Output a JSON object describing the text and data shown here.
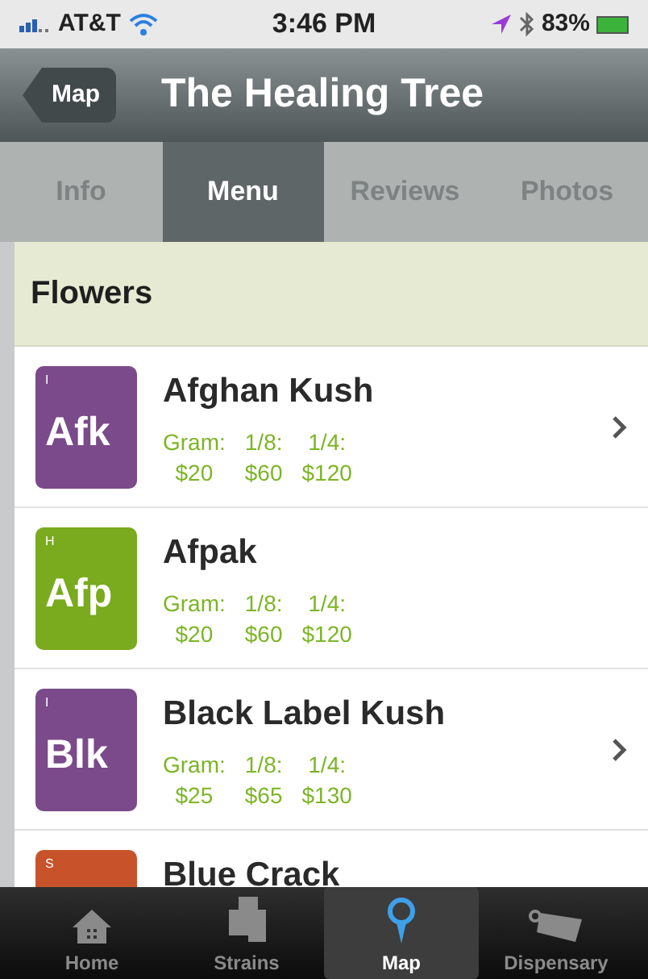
{
  "status_bar": {
    "carrier": "AT&T",
    "time": "3:46 PM",
    "battery": "83%"
  },
  "nav": {
    "back": "Map",
    "title": "The Healing Tree"
  },
  "tabs": [
    {
      "label": "Info",
      "selected": false
    },
    {
      "label": "Menu",
      "selected": true
    },
    {
      "label": "Reviews",
      "selected": false
    },
    {
      "label": "Photos",
      "selected": false
    }
  ],
  "section": "Flowers",
  "strains": [
    {
      "type_letter": "I",
      "abbr": "Afk",
      "color": "#7b4a8a",
      "name": "Afghan Kush",
      "chevron": true,
      "prices": [
        {
          "label": "Gram:",
          "value": "$20"
        },
        {
          "label": "1/8:",
          "value": "$60"
        },
        {
          "label": "1/4:",
          "value": "$120"
        }
      ]
    },
    {
      "type_letter": "H",
      "abbr": "Afp",
      "color": "#7aaa1e",
      "name": "Afpak",
      "chevron": false,
      "prices": [
        {
          "label": "Gram:",
          "value": "$20"
        },
        {
          "label": "1/8:",
          "value": "$60"
        },
        {
          "label": "1/4:",
          "value": "$120"
        }
      ]
    },
    {
      "type_letter": "I",
      "abbr": "Blk",
      "color": "#7b4a8a",
      "name": "Black Label Kush",
      "chevron": true,
      "prices": [
        {
          "label": "Gram:",
          "value": "$25"
        },
        {
          "label": "1/8:",
          "value": "$65"
        },
        {
          "label": "1/4:",
          "value": "$130"
        }
      ]
    },
    {
      "type_letter": "S",
      "color": "#c8532a",
      "name": "Blue Crack",
      "chevron": false
    }
  ],
  "tab_bar": [
    {
      "label": "Home",
      "kind": "home",
      "selected": false
    },
    {
      "label": "Strains",
      "kind": "strains",
      "selected": false
    },
    {
      "label": "Map",
      "kind": "pin",
      "selected": true
    },
    {
      "label": "Dispensary",
      "kind": "tag",
      "selected": false
    }
  ]
}
